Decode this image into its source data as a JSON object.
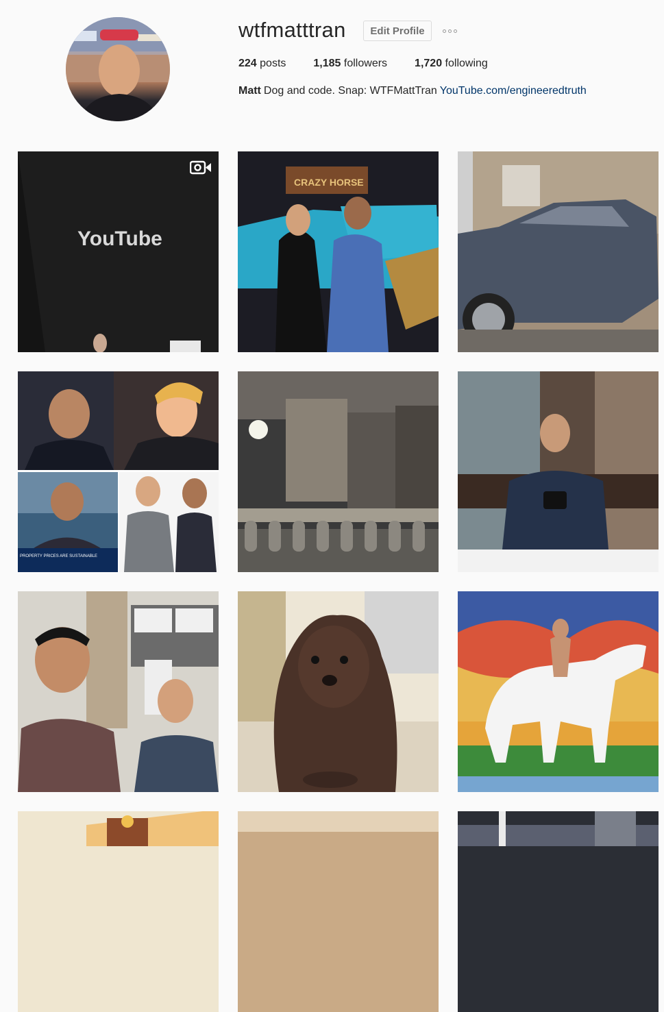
{
  "profile": {
    "username": "wtfmatttran",
    "edit_label": "Edit Profile",
    "more_icon": "ellipsis-icon",
    "stats": {
      "posts_count": "224",
      "posts_label": "posts",
      "followers_count": "1,185",
      "followers_label": "followers",
      "following_count": "1,720",
      "following_label": "following"
    },
    "bio": {
      "name": "Matt",
      "text": "Dog and code. Snap: WTFMattTran",
      "link": "YouTube.com/engineeredtruth"
    }
  },
  "posts": [
    {
      "video_icon": "video-camera-icon",
      "text": "YouTube"
    },
    {
      "sign_text": "CRAZY HORSE"
    },
    {},
    {
      "ticker_text": "PROPERTY PRICES ARE SUSTAINABLE"
    },
    {},
    {},
    {},
    {},
    {},
    {},
    {},
    {}
  ],
  "colors": {
    "link": "#003569",
    "text": "#262626",
    "background": "#fafafa",
    "button_border": "#dbdbdb"
  }
}
